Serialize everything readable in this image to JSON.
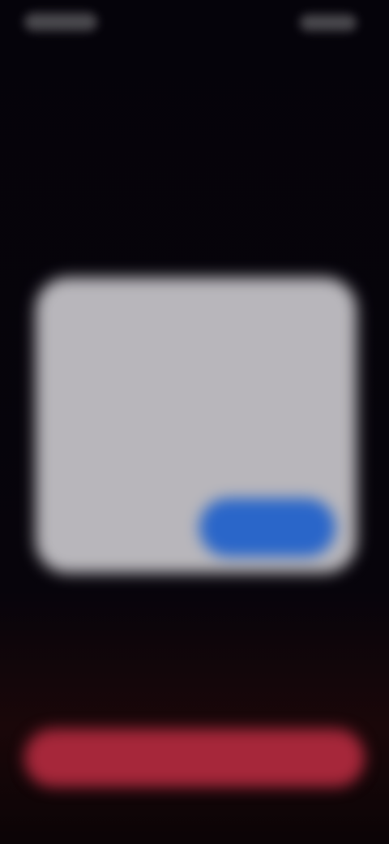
{
  "status_bar": {
    "time": "",
    "icons": [
      "signal-icon",
      "wifi-icon",
      "battery-icon"
    ]
  },
  "dialog": {
    "title": "",
    "body": "",
    "cancel_label": "",
    "confirm_label": ""
  },
  "primary_action": {
    "label": ""
  },
  "colors": {
    "background": "#06040a",
    "dialog": "#b8b6bb",
    "confirm": "#2a66c9",
    "primary_action": "#a6273a"
  }
}
